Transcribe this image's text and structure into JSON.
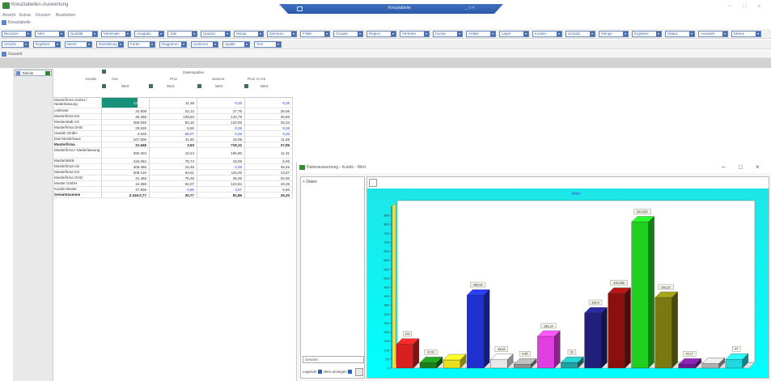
{
  "app": {
    "title": "Kreuztabellen-Auswertung"
  },
  "floating_window": {
    "title": "Kreuztabelle",
    "controls": "_ □ ×"
  },
  "window_controls": {
    "minimize": "–",
    "maximize": "□",
    "close": "×"
  },
  "menu": [
    "Ansicht",
    "Extras",
    "Drucken",
    "Bearbeiten"
  ],
  "quick_access": {
    "label": "Kreuztabelle"
  },
  "toolbar": {
    "row1": [
      "Benutzer",
      "Alter",
      "Qualität",
      "Merkmale",
      "Ausgabe",
      "Jahr",
      "Quartal",
      "Monat",
      "Zeitraum",
      "Filiale",
      "Gruppe",
      "Region",
      "Vertreter",
      "Kunde",
      "Artikel",
      "Lager",
      "Kosten",
      "Umsatz",
      "Menge",
      "Ergebnis",
      "Status",
      "Auswahl",
      "Ebene"
    ],
    "row2": [
      "Ansicht",
      "Ergebnis",
      "Werte",
      "Darstellung",
      "Farbe",
      "Diagramm",
      "Sortieren",
      "Spalte",
      "Text"
    ]
  },
  "status": {
    "text": "Gesamt"
  },
  "left_pane": {
    "item_label": "Tabelle"
  },
  "pivot": {
    "header_icon_label": "",
    "column_group": "Datenspalten",
    "row_header": "Kunde",
    "columns": [
      "Anz",
      "Proz",
      "Summe",
      "Proz % Ant"
    ],
    "subcolumns": [
      "Wert",
      "Wert",
      "Wert",
      "Wert"
    ],
    "rows": [
      {
        "label": "Musterfirma GmbH / Niederlassung",
        "values": [
          "132.404",
          "11,38",
          "0,28",
          "9,26"
        ],
        "blue": [
          false,
          false,
          true,
          true
        ],
        "bold": false
      },
      {
        "label": "Lieferant",
        "values": [
          "31.508",
          "22,12",
          "27,76",
          "25,06"
        ],
        "blue": [
          false,
          false,
          false,
          false
        ],
        "bold": false
      },
      {
        "label": "Musterfirma KG",
        "values": [
          "45.366",
          "128,63",
          "143,79",
          "26,66"
        ],
        "blue": [
          false,
          false,
          false,
          false
        ],
        "bold": false
      },
      {
        "label": "Musterstadt AG",
        "values": [
          "306.056",
          "84,16",
          "120,68",
          "34,04"
        ],
        "blue": [
          false,
          false,
          false,
          false
        ],
        "bold": false
      },
      {
        "label": "Musterfirma OHG",
        "values": [
          "20.526",
          "6,55",
          "0,28",
          "9,26"
        ],
        "blue": [
          false,
          false,
          true,
          true
        ],
        "bold": false
      },
      {
        "label": "Handel GmbH",
        "values": [
          "4.626",
          "68,07",
          "0,28",
          "9,26"
        ],
        "blue": [
          false,
          true,
          true,
          true
        ],
        "bold": false
      },
      {
        "label": "Das Musterhaus",
        "values": [
          "107.606",
          "41,80",
          "19,08",
          "11,89"
        ],
        "blue": [
          false,
          false,
          false,
          false
        ],
        "bold": false
      },
      {
        "label": "Musterfirma",
        "values": [
          "21.646",
          "3,93",
          "718,12",
          "27,85"
        ],
        "blue": [
          false,
          true,
          false,
          false
        ],
        "bold": true
      },
      {
        "label": "Musterfirma / Niederlassung",
        "values": [
          "392.404",
          "10,44",
          "106,90",
          "11,31"
        ],
        "blue": [
          false,
          false,
          false,
          false
        ],
        "bold": false
      },
      {
        "label": "Musterfabrik",
        "values": [
          "415.084",
          "75,74",
          "19,09",
          "5,06"
        ],
        "blue": [
          false,
          false,
          false,
          false
        ],
        "bold": false
      },
      {
        "label": "Musterfirma AG",
        "values": [
          "406.466",
          "10,46",
          "0,28",
          "48,46"
        ],
        "blue": [
          false,
          false,
          true,
          false
        ],
        "bold": false
      },
      {
        "label": "Musterfirma KG",
        "values": [
          "306.126",
          "93,61",
          "115,00",
          "13,57"
        ],
        "blue": [
          false,
          false,
          false,
          false
        ],
        "bold": false
      },
      {
        "label": "Musterfirma OHG",
        "values": [
          "31.456",
          "76,26",
          "36,05",
          "20,06"
        ],
        "blue": [
          false,
          false,
          false,
          false
        ],
        "bold": false
      },
      {
        "label": "Muster GmbH",
        "values": [
          "12.386",
          "92,07",
          "123,94",
          "43,26"
        ],
        "blue": [
          false,
          false,
          false,
          false
        ],
        "bold": false
      },
      {
        "label": "Kunde Muster",
        "values": [
          "47.606",
          "5,86",
          "4,57",
          "5,96"
        ],
        "blue": [
          false,
          true,
          true,
          false
        ],
        "bold": false
      },
      {
        "label": "Gesamtsumme",
        "values": [
          "2.416.0,77",
          "30,77",
          "82,86",
          "26,33"
        ],
        "blue": [
          false,
          false,
          false,
          false
        ],
        "bold": true
      }
    ]
  },
  "chart_window": {
    "title": "Datenauswertung - Kunde - Wert",
    "tree_label": "Daten",
    "combo_value": "Gesamt",
    "legend_label": "Legende",
    "values_label": "Wert anzeigen"
  },
  "chart_data": {
    "type": "bar",
    "title": "Wert",
    "xlabel": "",
    "ylabel": "",
    "ylim": [
      0,
      900
    ],
    "yticks": [
      0,
      50,
      100,
      150,
      200,
      250,
      300,
      350,
      400,
      450,
      500,
      550,
      600,
      650,
      700,
      750,
      800,
      850
    ],
    "background": "#1ee6e6",
    "bars": [
      {
        "value": 132,
        "label": "132",
        "color": "#d82020"
      },
      {
        "value": 30,
        "label": "31,51",
        "color": "#1a7f1a"
      },
      {
        "value": 45,
        "label": "",
        "color": "#e8e020"
      },
      {
        "value": 405,
        "label": "405,06",
        "color": "#2030d0"
      },
      {
        "value": 46,
        "label": "45,63",
        "color": "#e8e8e8"
      },
      {
        "value": 21,
        "label": "4,96",
        "color": "#909090"
      },
      {
        "value": 176,
        "label": "182,14",
        "color": "#e040e0"
      },
      {
        "value": 31,
        "label": "31",
        "color": "#20a0a0"
      },
      {
        "value": 306,
        "label": "306,4",
        "color": "#20207a"
      },
      {
        "value": 415,
        "label": "415,085",
        "color": "#8a1010"
      },
      {
        "value": 812,
        "label": "812,601",
        "color": "#20d020"
      },
      {
        "value": 392,
        "label": "392,37",
        "color": "#7a7a10"
      },
      {
        "value": 21,
        "label": "20,17",
        "color": "#6a1a8a"
      },
      {
        "value": 25,
        "label": "",
        "color": "#b0b0b0"
      },
      {
        "value": 48,
        "label": "47",
        "color": "#20d8e0"
      }
    ]
  }
}
